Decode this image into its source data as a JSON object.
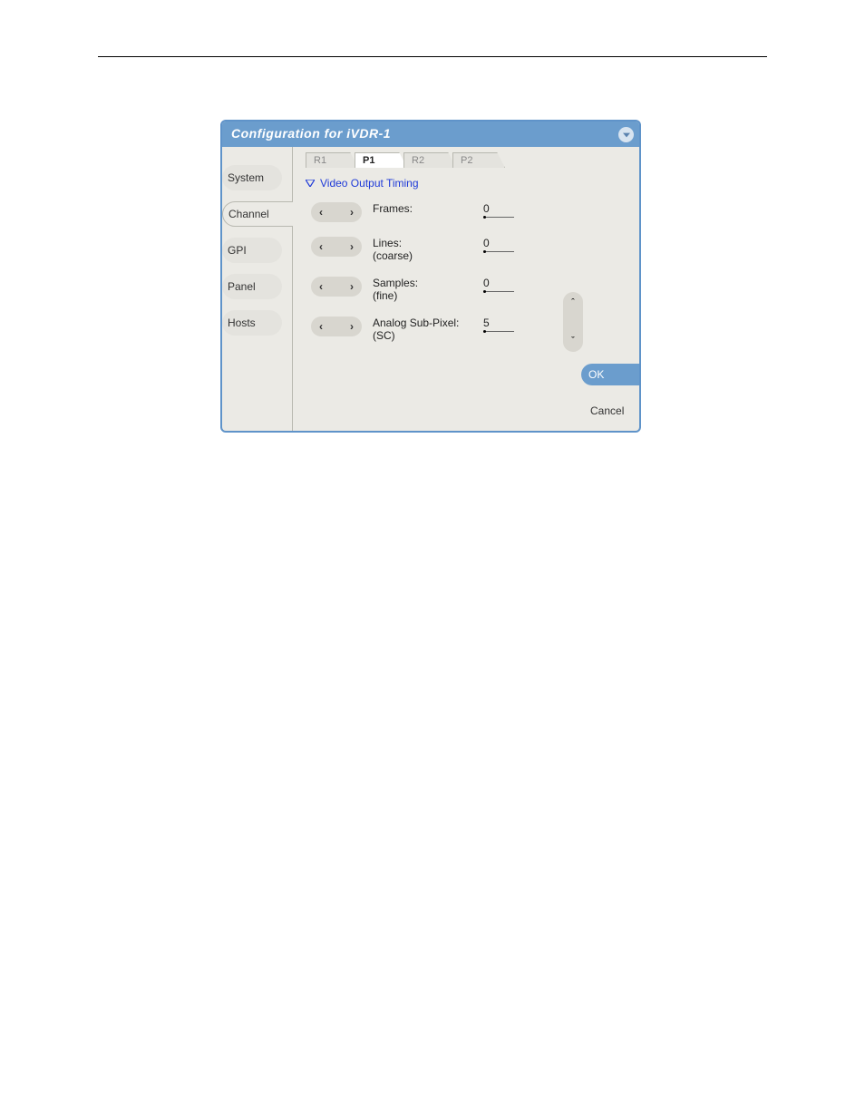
{
  "title": "Configuration for iVDR-1",
  "sidebar": {
    "items": [
      {
        "label": "System",
        "active": false
      },
      {
        "label": "Channel",
        "active": true
      },
      {
        "label": "GPI",
        "active": false
      },
      {
        "label": "Panel",
        "active": false
      },
      {
        "label": "Hosts",
        "active": false
      }
    ]
  },
  "tabs": [
    {
      "label": "R1",
      "active": false
    },
    {
      "label": "P1",
      "active": true
    },
    {
      "label": "R2",
      "active": false
    },
    {
      "label": "P2",
      "active": false
    }
  ],
  "section": {
    "header": "Video Output Timing",
    "params": [
      {
        "label": "Frames:",
        "sublabel": "",
        "value": "0"
      },
      {
        "label": "Lines:",
        "sublabel": "(coarse)",
        "value": "0"
      },
      {
        "label": "Samples:",
        "sublabel": "(fine)",
        "value": "0"
      },
      {
        "label": "Analog Sub-Pixel:",
        "sublabel": "(SC)",
        "value": "5"
      }
    ]
  },
  "actions": {
    "ok": "OK",
    "cancel": "Cancel"
  },
  "glyphs": {
    "left": "‹",
    "right": "›",
    "up": "ˆ",
    "down": "ˇ"
  }
}
